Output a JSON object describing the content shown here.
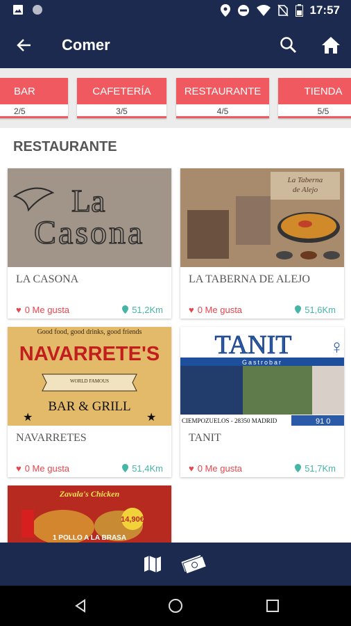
{
  "status_bar": {
    "time": "17:57",
    "icons": [
      "image-icon",
      "circle-icon",
      "location-icon",
      "dnd-icon",
      "wifi-icon",
      "no-sim-icon",
      "battery-icon"
    ]
  },
  "app_bar": {
    "title": "Comer",
    "icons": [
      "back-arrow-icon",
      "search-icon",
      "home-icon"
    ]
  },
  "tabs": [
    {
      "label": "BAR",
      "count": "2/5"
    },
    {
      "label": "CAFETERÍA",
      "count": "3/5"
    },
    {
      "label": "RESTAURANTE",
      "count": "4/5"
    },
    {
      "label": "TIENDA",
      "count": "5/5"
    }
  ],
  "section": {
    "title": "RESTAURANTE"
  },
  "restaurants": [
    {
      "name": "LA CASONA",
      "likes": "0 Me gusta",
      "distance": "51,2Km",
      "image_text": "La Casona"
    },
    {
      "name": "LA TABERNA DE ALEJO",
      "likes": "0 Me gusta",
      "distance": "51,6Km",
      "image_text": "La Taberna de Alejo"
    },
    {
      "name": "NAVARRETES",
      "likes": "0 Me gusta",
      "distance": "51,4Km",
      "image_text": "NAVARRETE'S",
      "image_subtext_top": "Good food, good drinks, good friends",
      "image_subtext_bottom": "BAR & GRILL",
      "image_banner": "WORLD FAMOUS"
    },
    {
      "name": "TANIT",
      "likes": "0 Me gusta",
      "distance": "51,7Km",
      "image_text": "TANIT",
      "image_subtext": "Gastrobar",
      "image_footer": "CIEMPOZUELOS - 28350 MADRID",
      "image_phone": "91 0"
    },
    {
      "name": "",
      "likes": "",
      "distance": "",
      "image_text": "Zavala's Chicken",
      "image_price": "14,90€",
      "image_footer": "1 POLLO A LA BRASA"
    }
  ],
  "bottom_nav": {
    "icons": [
      "map-icon",
      "money-icon"
    ]
  },
  "system_nav": {
    "icons": [
      "back-triangle-icon",
      "home-circle-icon",
      "recents-square-icon"
    ]
  },
  "colors": {
    "primary": "#1b2a4e",
    "accent": "#f0595f",
    "like": "#e5454c",
    "distance": "#45b5a5"
  }
}
